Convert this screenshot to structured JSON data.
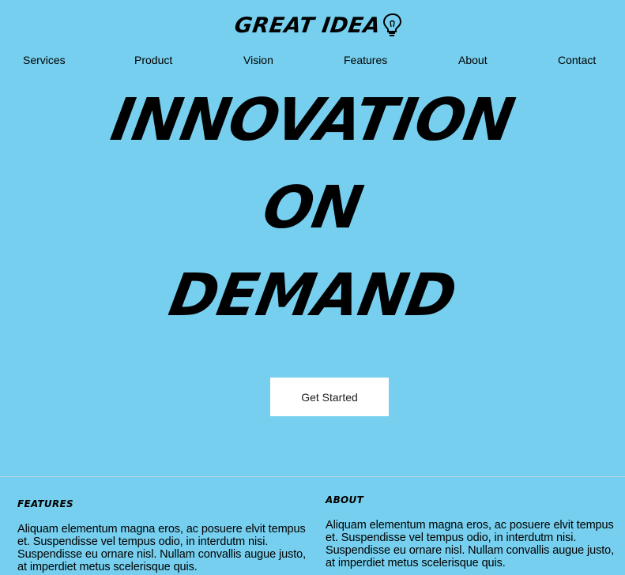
{
  "header": {
    "logo_text": "GREAT IDEA",
    "logo_icon": "lightbulb-icon"
  },
  "nav": {
    "items": [
      {
        "label": "Services"
      },
      {
        "label": "Product"
      },
      {
        "label": "Vision"
      },
      {
        "label": "Features"
      },
      {
        "label": "About"
      },
      {
        "label": "Contact"
      }
    ]
  },
  "hero": {
    "lines": [
      "INNOVATION",
      "ON",
      "DEMAND"
    ],
    "cta_label": "Get Started"
  },
  "sections": [
    {
      "heading": "FEATURES",
      "body": "Aliquam elementum magna eros, ac posuere elvit tempus et. Suspendisse vel tempus odio, in interdutm nisi. Suspendisse eu ornare nisl. Nullam convallis augue justo, at imperdiet metus scelerisque quis."
    },
    {
      "heading": "ABOUT",
      "body": "Aliquam elementum magna eros, ac posuere elvit tempus et. Suspendisse vel tempus odio, in interdutm nisi. Suspendisse eu ornare nisl. Nullam convallis augue justo, at imperdiet metus scelerisque quis."
    }
  ],
  "colors": {
    "background": "#76cfee",
    "button": "#ffffff",
    "text": "#000000"
  }
}
